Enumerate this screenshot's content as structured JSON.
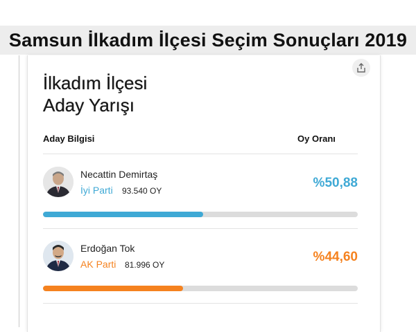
{
  "banner": {
    "title": "Samsun İlkadım İlçesi Seçim Sonuçları 2019"
  },
  "card": {
    "title_line1": "İlkadım İlçesi",
    "title_line2": "Aday Yarışı",
    "share_icon": "share-icon",
    "col_candidate": "Aday Bilgisi",
    "col_rate": "Oy Oranı"
  },
  "candidates": [
    {
      "name": "Necattin Demirtaş",
      "party": "İyi Parti",
      "votes": "93.540 OY",
      "percent_label": "%50,88",
      "percent": 50.88,
      "color": "#3fa9d5"
    },
    {
      "name": "Erdoğan Tok",
      "party": "AK Parti",
      "votes": "81.996 OY",
      "percent_label": "%44,60",
      "percent": 44.6,
      "color": "#f5821f"
    }
  ]
}
